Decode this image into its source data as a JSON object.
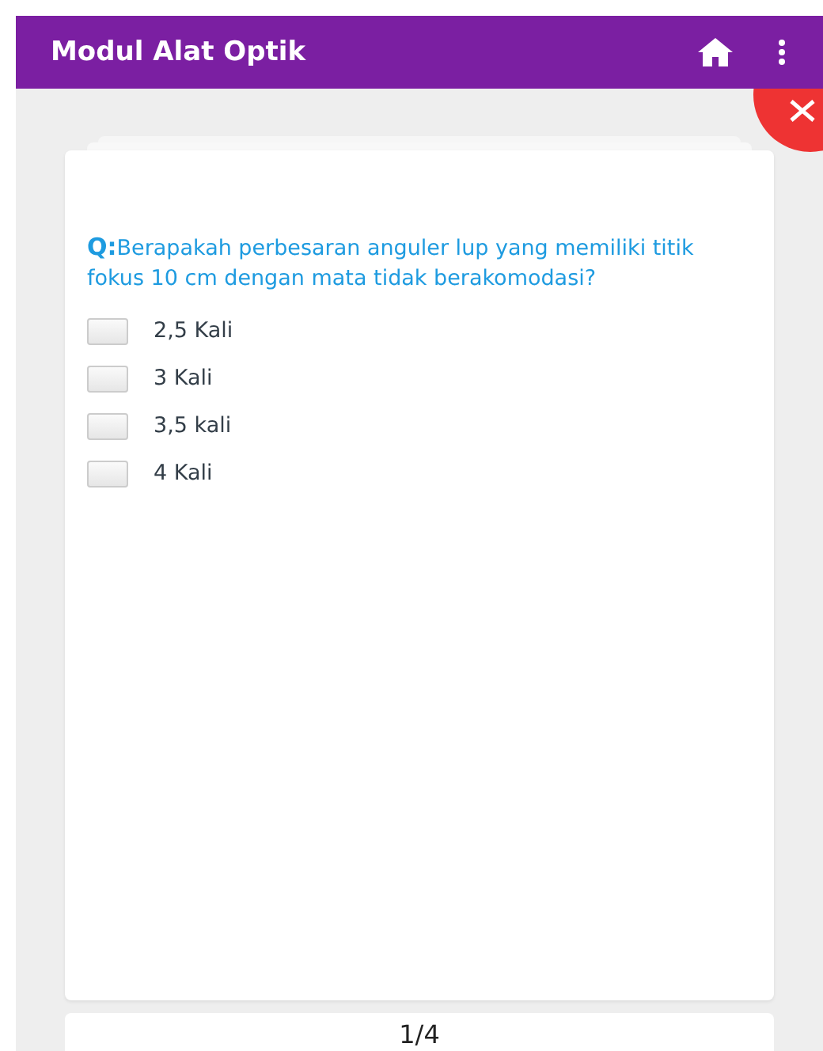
{
  "app_bar": {
    "title": "Modul Alat Optik"
  },
  "question": {
    "text": "**Q:**Berapakah perbesaran anguler lup yang memiliki titik fokus 10 cm dengan mata tidak berakomodasi?"
  },
  "options": [
    {
      "label": "2,5 Kali",
      "checked": false
    },
    {
      "label": "3 Kali",
      "checked": false
    },
    {
      "label": "3,5 kali",
      "checked": false
    },
    {
      "label": "4 Kali",
      "checked": false
    }
  ],
  "pager": {
    "text": "1/4"
  }
}
